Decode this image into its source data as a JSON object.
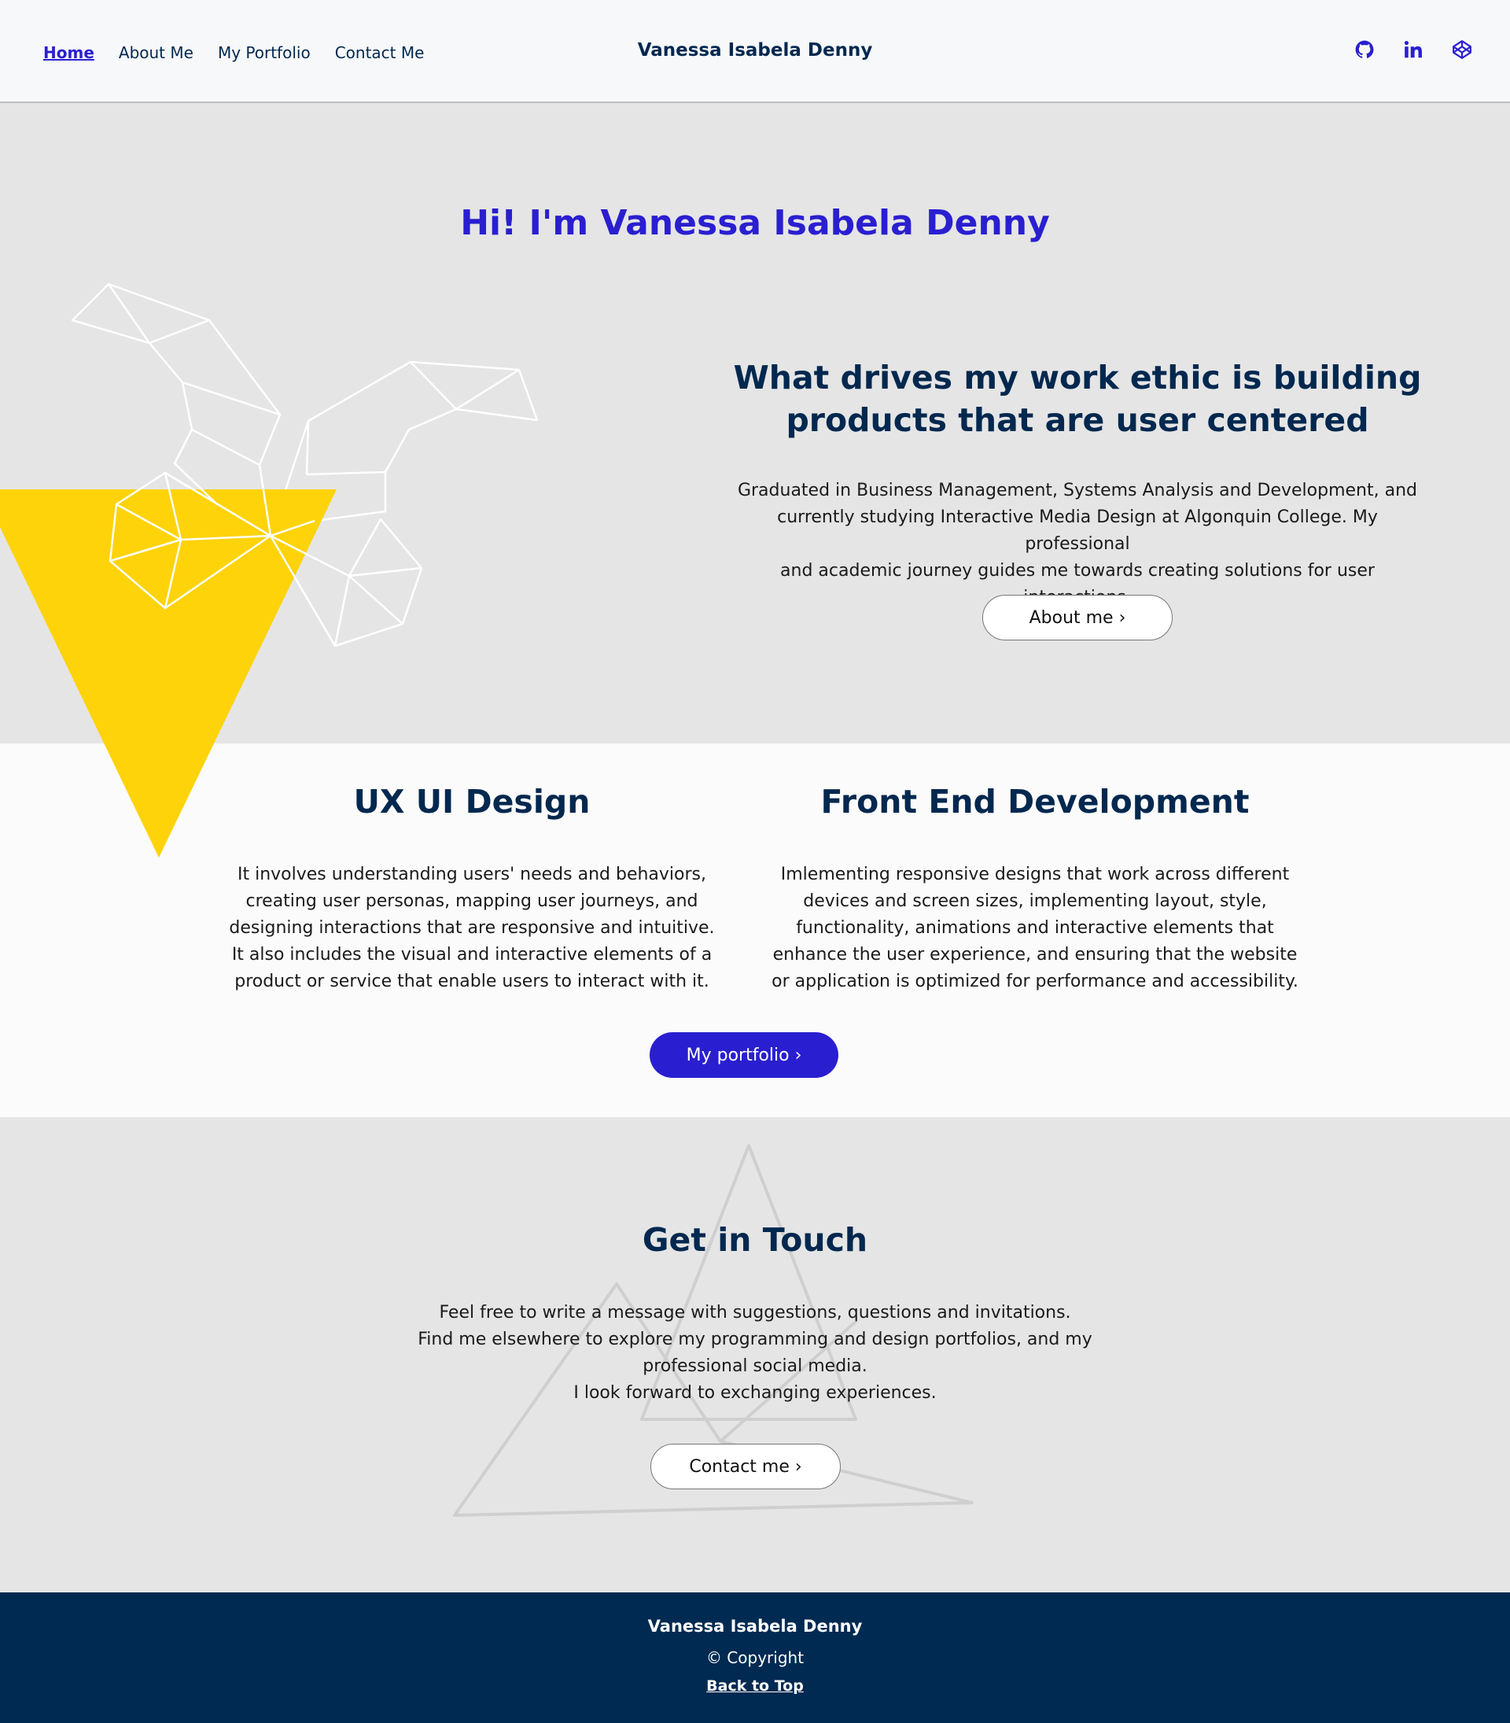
{
  "header": {
    "nav": [
      {
        "label": "Home",
        "active": true
      },
      {
        "label": "About Me",
        "active": false
      },
      {
        "label": "My Portfolio",
        "active": false
      },
      {
        "label": "Contact Me",
        "active": false
      }
    ],
    "brand": "Vanessa Isabela Denny",
    "social_icons": [
      "github-icon",
      "linkedin-icon",
      "codepen-icon"
    ]
  },
  "hero": {
    "title": "Hi! I'm Vanessa Isabela Denny",
    "heading_line1": "What drives my work ethic is building",
    "heading_line2": "products that are user centered",
    "text_line1": "Graduated in Business Management, Systems Analysis and Development, and",
    "text_line2": "currently studying Interactive Media Design at Algonquin College. My professional",
    "text_line3": "and academic journey guides me towards creating solutions for user interactions.",
    "button": "About me ›"
  },
  "services": {
    "ux": {
      "title": "UX UI Design",
      "lines": [
        "It involves understanding users' needs and behaviors,",
        "creating user personas, mapping user journeys, and",
        "designing interactions that are responsive and intuitive.",
        "It also includes the visual and interactive elements of a",
        "product or service that enable users to interact with it."
      ]
    },
    "fe": {
      "title": "Front End Development",
      "lines": [
        "Imlementing responsive designs that work across different",
        "devices and screen sizes, implementing layout, style,",
        "functionality, animations and interactive elements that",
        "enhance the user experience, and ensuring that the website",
        "or application is optimized for performance and accessibility."
      ]
    },
    "button": "My portfolio ›"
  },
  "contact": {
    "title": "Get in Touch",
    "lines": [
      "Feel free to write a message with suggestions, questions and invitations.",
      "Find me elsewhere to explore my programming and design portfolios, and my",
      "professional social media.",
      "I look forward to exchanging experiences."
    ],
    "button": "Contact me ›"
  },
  "footer": {
    "name": "Vanessa Isabela Denny",
    "copyright": "©  Copyright",
    "back_to_top": "Back to Top"
  },
  "colors": {
    "accent": "#2a1fd0",
    "navy": "#02284f",
    "yellow": "#ffd30a",
    "footer_bg": "#002a52"
  }
}
